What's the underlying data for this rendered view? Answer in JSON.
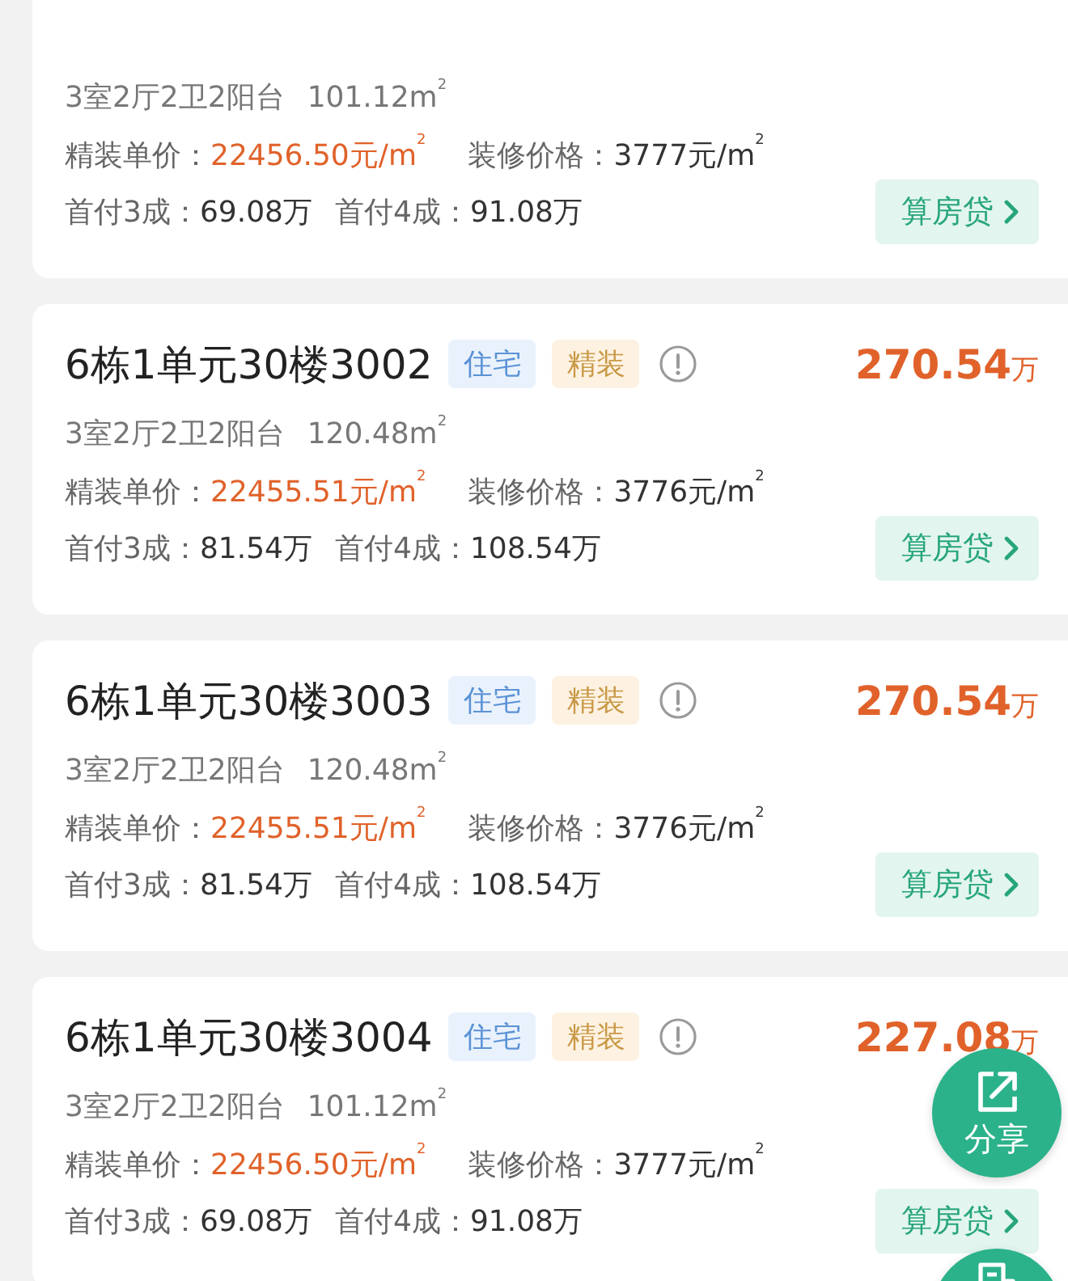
{
  "listings": [
    {
      "layout": "3室2厅2卫2阳台",
      "area": "101.12m$^{2}$",
      "unit_price_label": "精装单价：",
      "unit_price": "22456.50元/m$^{2}$",
      "deco_label": "装修价格：",
      "deco_price": "3777元/m$^{2}$",
      "down_payments": [
        {
          "label": "首付3成：",
          "value": "69.08万"
        },
        {
          "label": "首付4成：",
          "value": "91.08万"
        }
      ],
      "loan_button": "算房贷"
    },
    {
      "title": "6栋1单元30楼3002",
      "tags": [
        {
          "kind": "usage",
          "label": "住宅"
        },
        {
          "kind": "finish",
          "label": "精装"
        }
      ],
      "price": "270.54",
      "price_unit": "万",
      "layout": "3室2厅2卫2阳台",
      "area": "120.48m$^{2}$",
      "unit_price_label": "精装单价：",
      "unit_price": "22455.51元/m$^{2}$",
      "deco_label": "装修价格：",
      "deco_price": "3776元/m$^{2}$",
      "down_payments": [
        {
          "label": "首付3成：",
          "value": "81.54万"
        },
        {
          "label": "首付4成：",
          "value": "108.54万"
        }
      ],
      "loan_button": "算房贷"
    },
    {
      "title": "6栋1单元30楼3003",
      "tags": [
        {
          "kind": "usage",
          "label": "住宅"
        },
        {
          "kind": "finish",
          "label": "精装"
        }
      ],
      "price": "270.54",
      "price_unit": "万",
      "layout": "3室2厅2卫2阳台",
      "area": "120.48m$^{2}$",
      "unit_price_label": "精装单价：",
      "unit_price": "22455.51元/m$^{2}$",
      "deco_label": "装修价格：",
      "deco_price": "3776元/m$^{2}$",
      "down_payments": [
        {
          "label": "首付3成：",
          "value": "81.54万"
        },
        {
          "label": "首付4成：",
          "value": "108.54万"
        }
      ],
      "loan_button": "算房贷"
    },
    {
      "title": "6栋1单元30楼3004",
      "tags": [
        {
          "kind": "usage",
          "label": "住宅"
        },
        {
          "kind": "finish",
          "label": "精装"
        }
      ],
      "price": "227.08",
      "price_unit": "万",
      "layout": "3室2厅2卫2阳台",
      "area": "101.12m$^{2}$",
      "unit_price_label": "精装单价：",
      "unit_price": "22456.50元/m$^{2}$",
      "deco_label": "装修价格：",
      "deco_price": "3777元/m$^{2}$",
      "down_payments": [
        {
          "label": "首付3成：",
          "value": "69.08万"
        },
        {
          "label": "首付4成：",
          "value": "91.08万"
        }
      ],
      "loan_button": "算房贷"
    }
  ],
  "floating_buttons": [
    {
      "kind": "share",
      "label": "分享"
    },
    {
      "kind": "document"
    }
  ]
}
